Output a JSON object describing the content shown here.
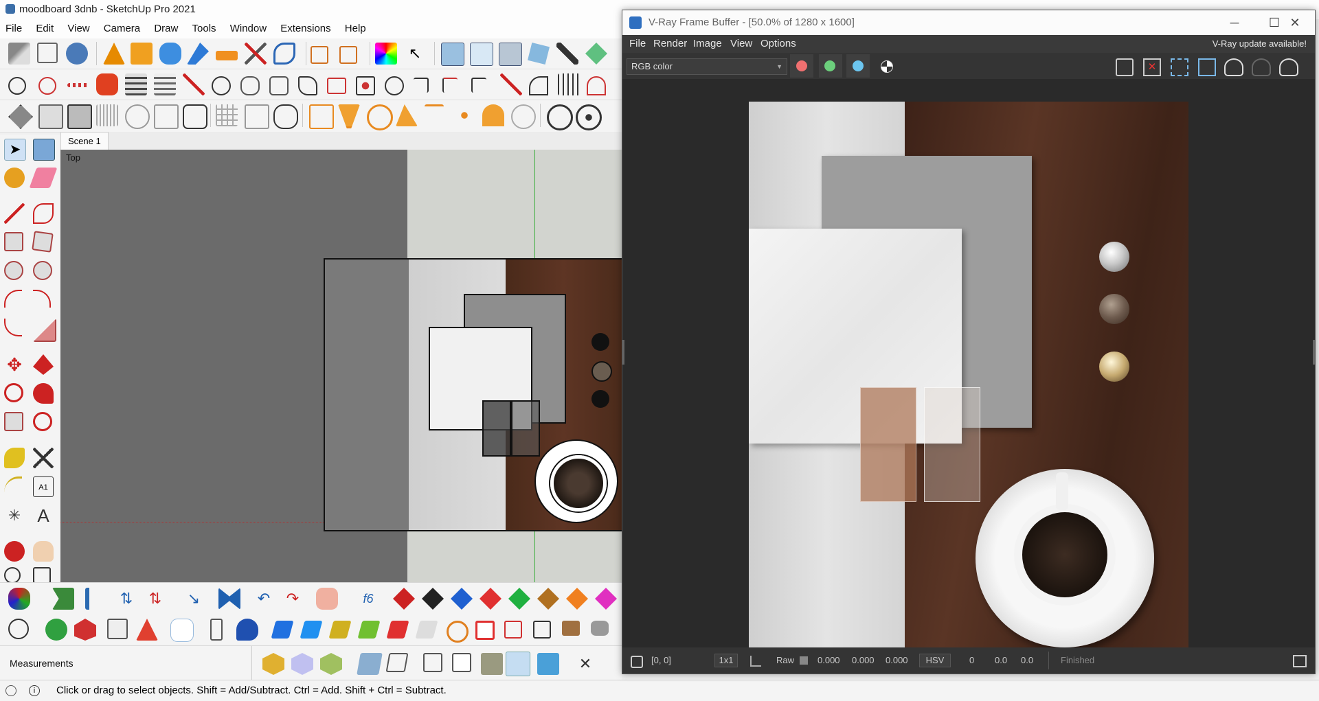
{
  "sketchup": {
    "title": "moodboard 3dnb - SketchUp Pro 2021",
    "menu": [
      "File",
      "Edit",
      "View",
      "Camera",
      "Draw",
      "Tools",
      "Window",
      "Extensions",
      "Help"
    ],
    "scene_tab": "Scene 1",
    "view_label": "Top",
    "measurements_label": "Measurements",
    "status_text": "Click or drag to select objects. Shift = Add/Subtract. Ctrl = Add. Shift + Ctrl = Subtract."
  },
  "vray": {
    "title": "V-Ray Frame Buffer - [50.0% of 1280 x 1600]",
    "menu": [
      "File",
      "Render",
      "Image",
      "View",
      "Options"
    ],
    "update_notice": "V-Ray update available!",
    "channel_select": "RGB color",
    "channel_colors": [
      "#f07070",
      "#6ccf7c",
      "#6cc6f0"
    ],
    "bottom": {
      "coords": "[0, 0]",
      "sample": "1x1",
      "raw_label": "Raw",
      "values": [
        "0.000",
        "0.000",
        "0.000"
      ],
      "color_mode": "HSV",
      "hsv_values": [
        "0",
        "0.0",
        "0.0"
      ],
      "status": "Finished"
    }
  },
  "icons": [
    "sketchup-logo-icon",
    "select-arrow-icon",
    "paint-bucket-icon",
    "eraser-icon",
    "pencil-icon",
    "rectangle-icon",
    "circle-icon",
    "arc-icon",
    "move-icon",
    "rotate-icon",
    "scale-icon",
    "tape-measure-icon",
    "text-icon",
    "orbit-icon",
    "pan-icon",
    "zoom-icon",
    "minimize-icon",
    "maximize-icon",
    "close-icon",
    "save-image-icon",
    "clear-image-icon",
    "region-render-icon",
    "teapot-render-icon"
  ]
}
